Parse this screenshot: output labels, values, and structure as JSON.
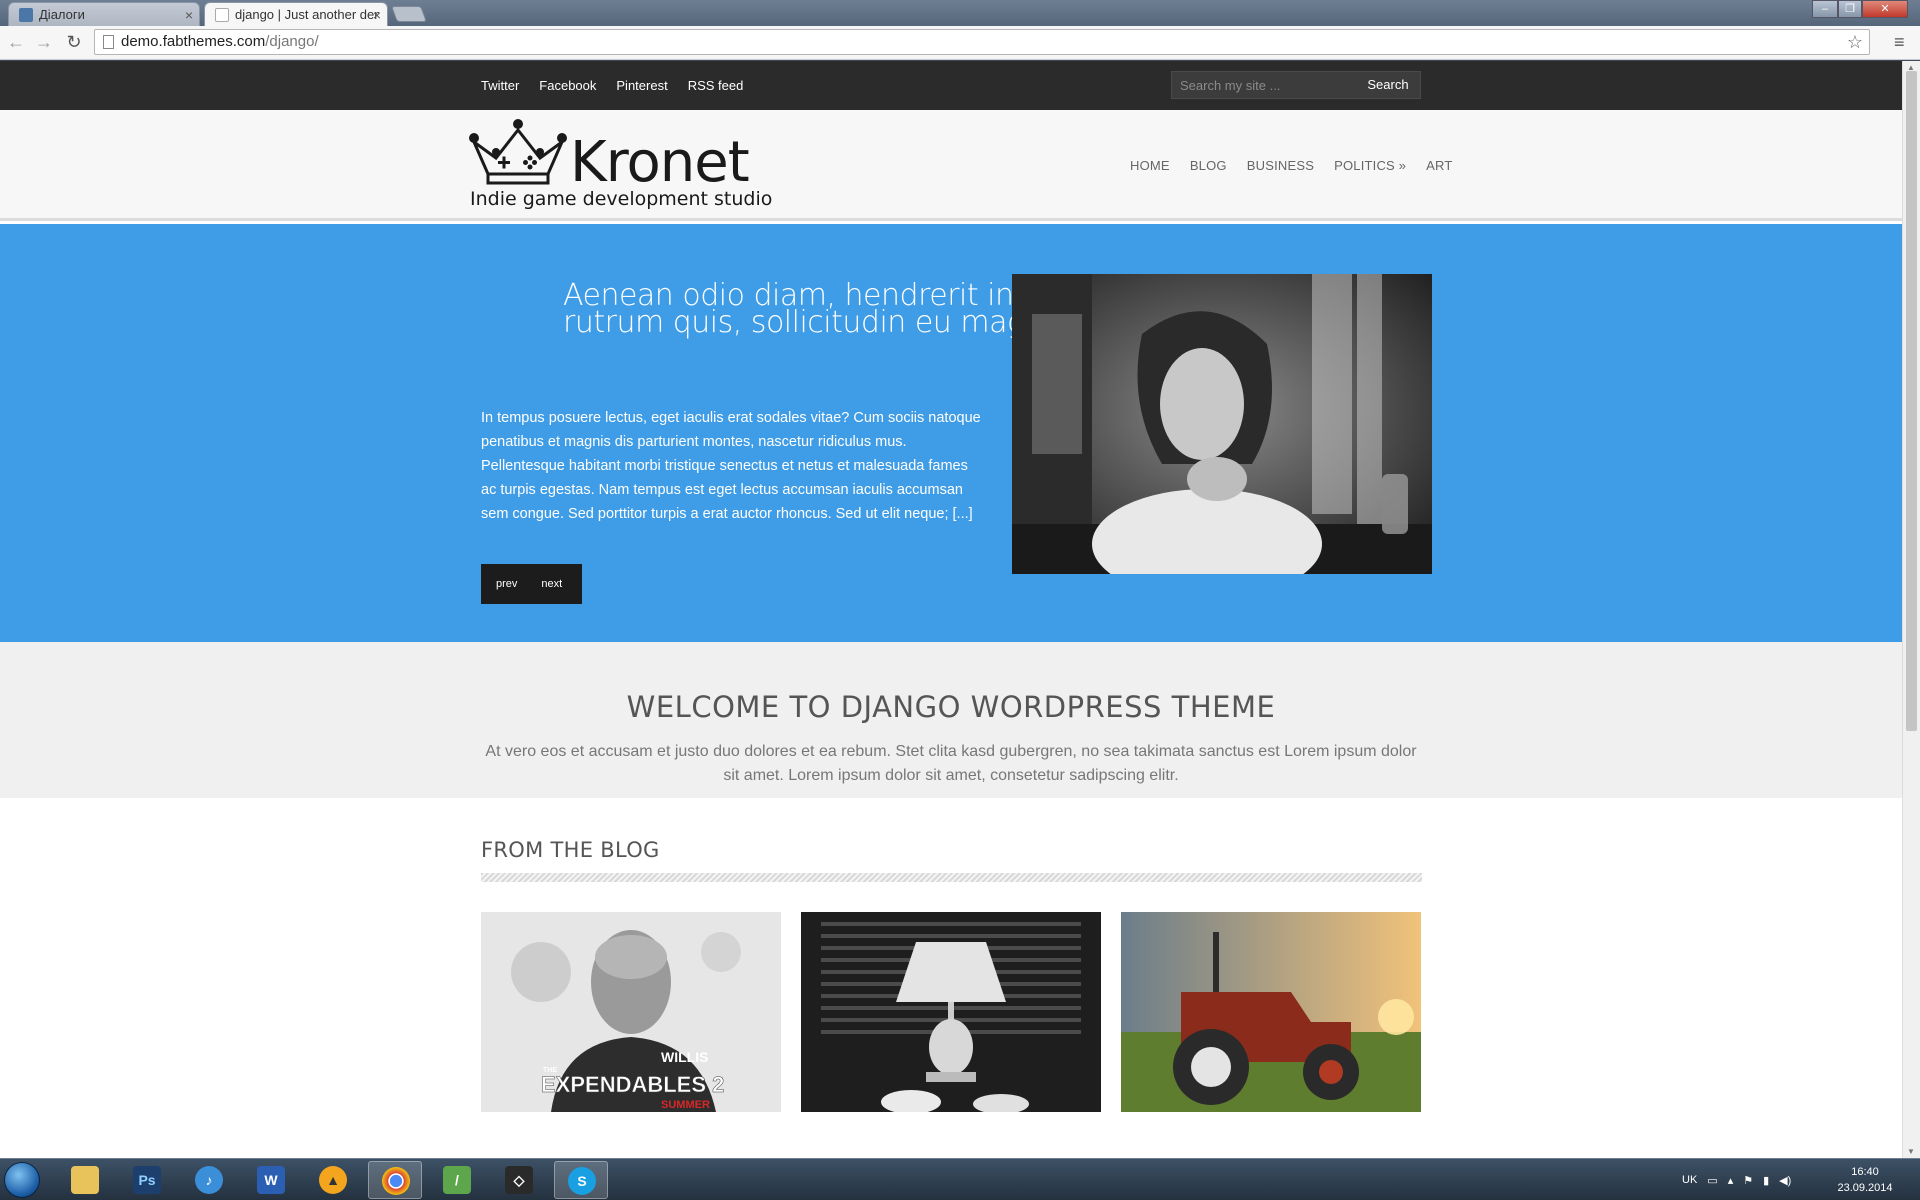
{
  "browser": {
    "tabs": [
      {
        "label": "Діалоги",
        "active": false
      },
      {
        "label": "django | Just another dem",
        "active": true
      }
    ],
    "url_host": "demo.fabthemes.com",
    "url_path": "/django/"
  },
  "site": {
    "social_links": [
      "Twitter",
      "Facebook",
      "Pinterest",
      "RSS feed"
    ],
    "search": {
      "placeholder": "Search my site ...",
      "button": "Search"
    },
    "logo": {
      "brand": "Kronet",
      "tagline": "Indie game development studio"
    },
    "nav": [
      "HOME",
      "BLOG",
      "BUSINESS",
      "POLITICS »",
      "ART"
    ],
    "hero": {
      "title": "Aenean odio diam, hendrerit in rutrum quis, sollicitudin eu magna",
      "text": "In tempus posuere lectus, eget iaculis erat sodales vitae? Cum sociis natoque penatibus et magnis dis parturient montes, nascetur ridiculus mus. Pellentesque habitant morbi tristique senectus et netus et malesuada fames ac turpis egestas. Nam tempus est eget lectus accumsan iaculis accumsan sem congue. Sed porttitor turpis a erat auctor rhoncus. Sed ut elit neque; [...]",
      "prev": "prev",
      "next": "next"
    },
    "welcome": {
      "title": "WELCOME TO DJANGO WORDPRESS THEME",
      "text": "At vero eos et accusam et justo duo dolores et ea rebum. Stet clita kasd gubergren, no sea takimata sanctus est Lorem ipsum dolor sit amet. Lorem ipsum dolor sit amet, consetetur sadipscing elitr."
    },
    "blog": {
      "heading": "FROM THE BLOG",
      "poster_text": {
        "name": "WILLIS",
        "title_prefix": "THE",
        "title": "EXPENDABLES 2",
        "tagline": "SUMMER"
      }
    }
  },
  "taskbar": {
    "language": "UK",
    "time": "16:40",
    "date": "23.09.2014"
  }
}
